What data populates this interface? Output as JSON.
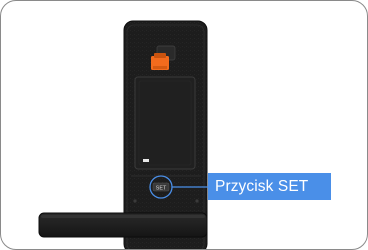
{
  "callout": {
    "label": "Przycisk SET",
    "color": "#4a8fe8"
  },
  "device": {
    "button_text": "SET",
    "body_color": "#1e1e1e",
    "latch_color": "#f26b1d"
  },
  "icons": {
    "lock": "door-lock-illustration",
    "button": "set-button-icon"
  }
}
